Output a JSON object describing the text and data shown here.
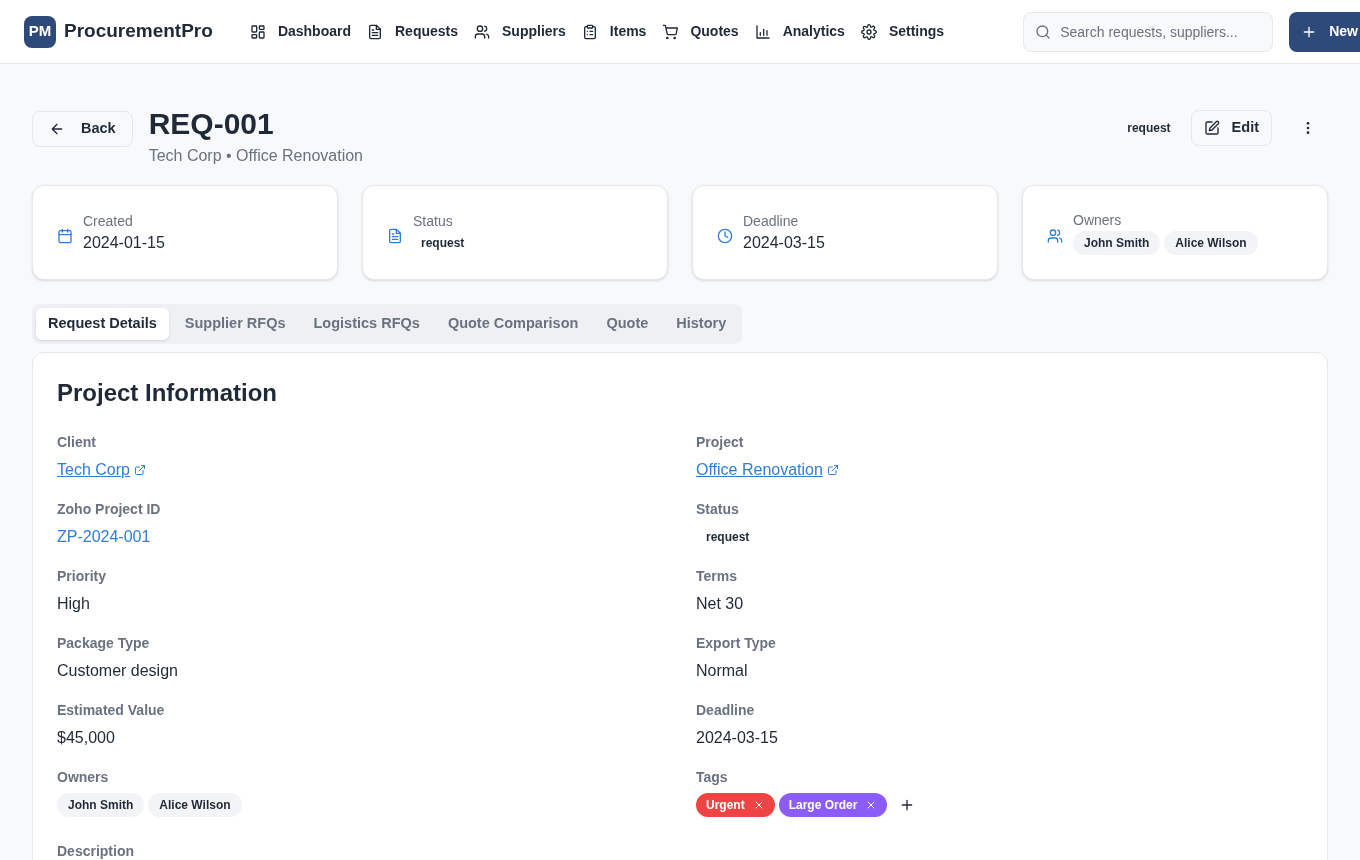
{
  "brand": {
    "logo": "PM",
    "name": "ProcurementPro"
  },
  "nav": [
    {
      "label": "Dashboard"
    },
    {
      "label": "Requests"
    },
    {
      "label": "Suppliers"
    },
    {
      "label": "Items"
    },
    {
      "label": "Quotes"
    },
    {
      "label": "Analytics"
    },
    {
      "label": "Settings"
    }
  ],
  "search": {
    "placeholder": "Search requests, suppliers..."
  },
  "new_button": {
    "label": "New"
  },
  "header": {
    "back": "Back",
    "title": "REQ-001",
    "subtitle": "Tech Corp • Office Renovation",
    "status": "request",
    "edit": "Edit"
  },
  "stats": [
    {
      "kind": "date",
      "label": "Created",
      "value": "2024-01-15"
    },
    {
      "kind": "badge",
      "label": "Status",
      "value": "request"
    },
    {
      "kind": "date",
      "label": "Deadline",
      "value": "2024-03-15"
    },
    {
      "kind": "chips",
      "label": "Owners",
      "values": [
        "John Smith",
        "Alice Wilson"
      ]
    }
  ],
  "tabs": [
    {
      "label": "Request Details",
      "selected": true
    },
    {
      "label": "Supplier RFQs",
      "selected": false
    },
    {
      "label": "Logistics RFQs",
      "selected": false
    },
    {
      "label": "Quote Comparison",
      "selected": false
    },
    {
      "label": "Quote",
      "selected": false
    },
    {
      "label": "History",
      "selected": false
    }
  ],
  "section": {
    "title": "Project Information",
    "fields": [
      {
        "kind": "link",
        "label": "Client",
        "value": "Tech Corp"
      },
      {
        "kind": "link",
        "label": "Project",
        "value": "Office Renovation"
      },
      {
        "kind": "id",
        "label": "Zoho Project ID",
        "value": "ZP-2024-001"
      },
      {
        "kind": "badge",
        "label": "Status",
        "value": "request"
      },
      {
        "kind": "text",
        "label": "Priority",
        "value": "High"
      },
      {
        "kind": "text",
        "label": "Terms",
        "value": "Net 30"
      },
      {
        "kind": "text",
        "label": "Package Type",
        "value": "Customer design"
      },
      {
        "kind": "text",
        "label": "Export Type",
        "value": "Normal"
      },
      {
        "kind": "text",
        "label": "Estimated Value",
        "value": "$45,000"
      },
      {
        "kind": "text",
        "label": "Deadline",
        "value": "2024-03-15"
      },
      {
        "kind": "chips",
        "label": "Owners",
        "values": [
          "John Smith",
          "Alice Wilson"
        ]
      },
      {
        "kind": "tags",
        "label": "Tags",
        "tags": [
          {
            "label": "Urgent",
            "color": "#ef4444"
          },
          {
            "label": "Large Order",
            "color": "#8b5cf6"
          }
        ]
      }
    ],
    "next_label": "Description"
  }
}
